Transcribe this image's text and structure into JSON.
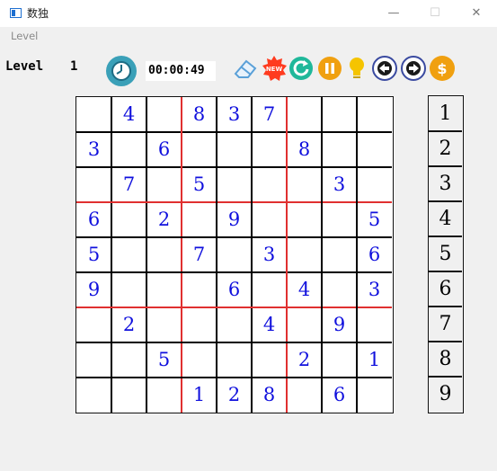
{
  "window": {
    "title": "数独"
  },
  "menu": {
    "items": [
      "Level"
    ]
  },
  "toolbar": {
    "level_label": "Level",
    "level_value": "1",
    "timer": "00:00:49"
  },
  "tools": [
    {
      "name": "eraser-icon",
      "color": "#5aa0d8"
    },
    {
      "name": "new-game-icon",
      "color": "#ff3b1f"
    },
    {
      "name": "restart-icon",
      "color": "#1fb89a"
    },
    {
      "name": "pause-icon",
      "color": "#f0a010"
    },
    {
      "name": "hint-bulb-icon",
      "color": "#f5c400"
    },
    {
      "name": "back-arrow-icon",
      "color": "#3a4aa0"
    },
    {
      "name": "forward-arrow-icon",
      "color": "#3a4aa0"
    },
    {
      "name": "coin-icon",
      "color": "#f0a010"
    }
  ],
  "colors": {
    "given_digit": "#1010dd",
    "box_line": "#e03030",
    "cell_line": "#000000"
  },
  "board": [
    [
      "",
      "4",
      "",
      "8",
      "3",
      "7",
      "",
      "",
      ""
    ],
    [
      "3",
      "",
      "6",
      "",
      "",
      "",
      "8",
      "",
      ""
    ],
    [
      "",
      "7",
      "",
      "5",
      "",
      "",
      "",
      "3",
      ""
    ],
    [
      "6",
      "",
      "2",
      "",
      "9",
      "",
      "",
      "",
      "5"
    ],
    [
      "5",
      "",
      "",
      "7",
      "",
      "3",
      "",
      "",
      "6"
    ],
    [
      "9",
      "",
      "",
      "",
      "6",
      "",
      "4",
      "",
      "3"
    ],
    [
      "",
      "2",
      "",
      "",
      "",
      "4",
      "",
      "9",
      ""
    ],
    [
      "",
      "",
      "5",
      "",
      "",
      "",
      "2",
      "",
      "1"
    ],
    [
      "",
      "",
      "",
      "1",
      "2",
      "8",
      "",
      "6",
      ""
    ]
  ],
  "palette": [
    "1",
    "2",
    "3",
    "4",
    "5",
    "6",
    "7",
    "8",
    "9"
  ]
}
